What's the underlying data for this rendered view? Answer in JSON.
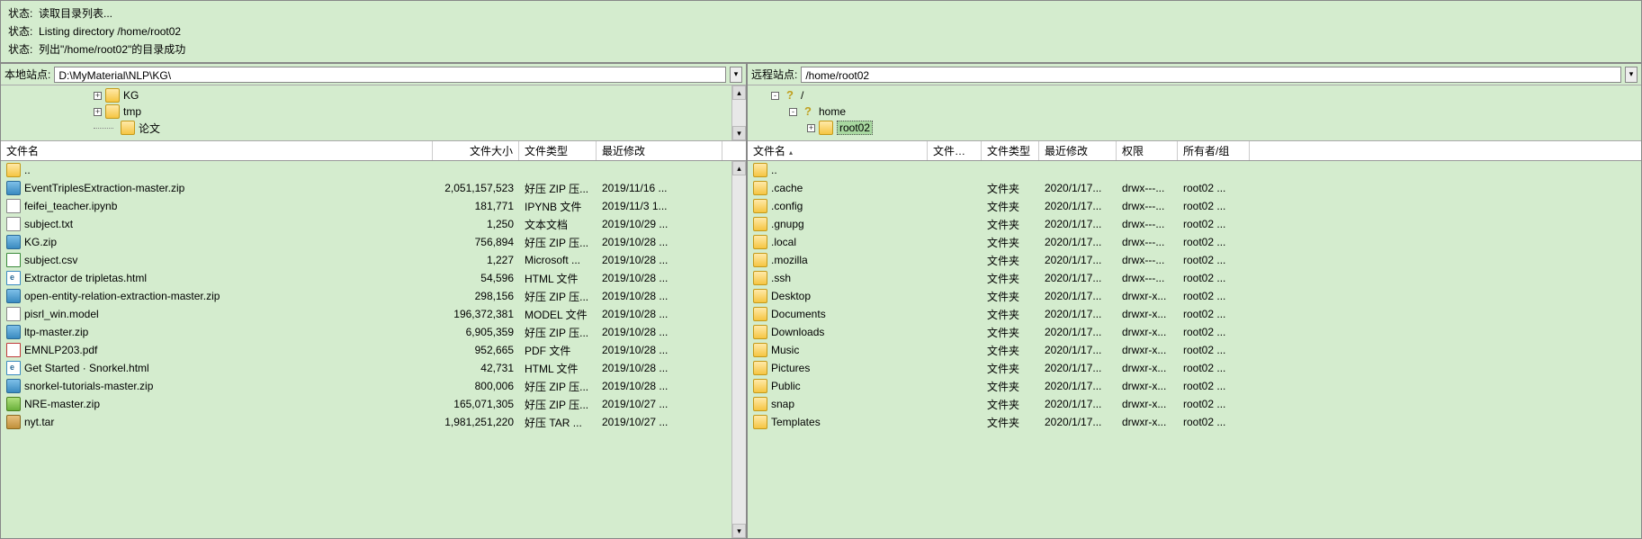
{
  "status": {
    "label": "状态:",
    "lines": [
      "读取目录列表...",
      "Listing directory /home/root02",
      "列出\"/home/root02\"的目录成功"
    ]
  },
  "local": {
    "addr_label": "本地站点:",
    "addr_value": "D:\\MyMaterial\\NLP\\KG\\",
    "tree": [
      {
        "indent": 1,
        "expander": "+",
        "icon": "folder",
        "name": "KG"
      },
      {
        "indent": 1,
        "expander": "+",
        "icon": "folder",
        "name": "tmp"
      },
      {
        "indent": 1,
        "expander": "",
        "icon": "folder",
        "name": "论文"
      }
    ],
    "headers": {
      "name": "文件名",
      "size": "文件大小",
      "type": "文件类型",
      "mod": "最近修改"
    },
    "files": [
      {
        "icon": "folder-up",
        "name": "..",
        "size": "",
        "type": "",
        "mod": ""
      },
      {
        "icon": "zip",
        "name": "EventTriplesExtraction-master.zip",
        "size": "2,051,157,523",
        "type": "好压 ZIP 压...",
        "mod": "2019/11/16 ..."
      },
      {
        "icon": "file",
        "name": "feifei_teacher.ipynb",
        "size": "181,771",
        "type": "IPYNB 文件",
        "mod": "2019/11/3 1..."
      },
      {
        "icon": "file",
        "name": "subject.txt",
        "size": "1,250",
        "type": "文本文档",
        "mod": "2019/10/29 ..."
      },
      {
        "icon": "zip",
        "name": "KG.zip",
        "size": "756,894",
        "type": "好压 ZIP 压...",
        "mod": "2019/10/28 ..."
      },
      {
        "icon": "csv",
        "name": "subject.csv",
        "size": "1,227",
        "type": "Microsoft ...",
        "mod": "2019/10/28 ..."
      },
      {
        "icon": "html",
        "name": "Extractor de tripletas.html",
        "size": "54,596",
        "type": "HTML 文件",
        "mod": "2019/10/28 ..."
      },
      {
        "icon": "zip",
        "name": "open-entity-relation-extraction-master.zip",
        "size": "298,156",
        "type": "好压 ZIP 压...",
        "mod": "2019/10/28 ..."
      },
      {
        "icon": "model",
        "name": "pisrl_win.model",
        "size": "196,372,381",
        "type": "MODEL 文件",
        "mod": "2019/10/28 ..."
      },
      {
        "icon": "zip",
        "name": "ltp-master.zip",
        "size": "6,905,359",
        "type": "好压 ZIP 压...",
        "mod": "2019/10/28 ..."
      },
      {
        "icon": "pdf",
        "name": "EMNLP203.pdf",
        "size": "952,665",
        "type": "PDF 文件",
        "mod": "2019/10/28 ..."
      },
      {
        "icon": "html",
        "name": "Get Started · Snorkel.html",
        "size": "42,731",
        "type": "HTML 文件",
        "mod": "2019/10/28 ..."
      },
      {
        "icon": "zip",
        "name": "snorkel-tutorials-master.zip",
        "size": "800,006",
        "type": "好压 ZIP 压...",
        "mod": "2019/10/28 ..."
      },
      {
        "icon": "zip2",
        "name": "NRE-master.zip",
        "size": "165,071,305",
        "type": "好压 ZIP 压...",
        "mod": "2019/10/27 ..."
      },
      {
        "icon": "tar",
        "name": "nyt.tar",
        "size": "1,981,251,220",
        "type": "好压 TAR ...",
        "mod": "2019/10/27 ..."
      }
    ]
  },
  "remote": {
    "addr_label": "远程站点:",
    "addr_value": "/home/root02",
    "tree": [
      {
        "indent": 2,
        "expander": "-",
        "icon": "q",
        "name": "/"
      },
      {
        "indent": 3,
        "expander": "-",
        "icon": "q",
        "name": "home"
      },
      {
        "indent": 4,
        "expander": "+",
        "icon": "folder",
        "name": "root02",
        "selected": true
      }
    ],
    "headers": {
      "name": "文件名",
      "size": "文件大小",
      "type": "文件类型",
      "mod": "最近修改",
      "perm": "权限",
      "own": "所有者/组"
    },
    "files": [
      {
        "icon": "folder-up",
        "name": "..",
        "size": "",
        "type": "",
        "mod": "",
        "perm": "",
        "own": ""
      },
      {
        "icon": "folder",
        "name": ".cache",
        "size": "",
        "type": "文件夹",
        "mod": "2020/1/17...",
        "perm": "drwx---...",
        "own": "root02 ..."
      },
      {
        "icon": "folder",
        "name": ".config",
        "size": "",
        "type": "文件夹",
        "mod": "2020/1/17...",
        "perm": "drwx---...",
        "own": "root02 ..."
      },
      {
        "icon": "folder",
        "name": ".gnupg",
        "size": "",
        "type": "文件夹",
        "mod": "2020/1/17...",
        "perm": "drwx---...",
        "own": "root02 ..."
      },
      {
        "icon": "folder",
        "name": ".local",
        "size": "",
        "type": "文件夹",
        "mod": "2020/1/17...",
        "perm": "drwx---...",
        "own": "root02 ..."
      },
      {
        "icon": "folder",
        "name": ".mozilla",
        "size": "",
        "type": "文件夹",
        "mod": "2020/1/17...",
        "perm": "drwx---...",
        "own": "root02 ..."
      },
      {
        "icon": "folder",
        "name": ".ssh",
        "size": "",
        "type": "文件夹",
        "mod": "2020/1/17...",
        "perm": "drwx---...",
        "own": "root02 ..."
      },
      {
        "icon": "folder",
        "name": "Desktop",
        "size": "",
        "type": "文件夹",
        "mod": "2020/1/17...",
        "perm": "drwxr-x...",
        "own": "root02 ..."
      },
      {
        "icon": "folder",
        "name": "Documents",
        "size": "",
        "type": "文件夹",
        "mod": "2020/1/17...",
        "perm": "drwxr-x...",
        "own": "root02 ..."
      },
      {
        "icon": "folder",
        "name": "Downloads",
        "size": "",
        "type": "文件夹",
        "mod": "2020/1/17...",
        "perm": "drwxr-x...",
        "own": "root02 ..."
      },
      {
        "icon": "folder",
        "name": "Music",
        "size": "",
        "type": "文件夹",
        "mod": "2020/1/17...",
        "perm": "drwxr-x...",
        "own": "root02 ..."
      },
      {
        "icon": "folder",
        "name": "Pictures",
        "size": "",
        "type": "文件夹",
        "mod": "2020/1/17...",
        "perm": "drwxr-x...",
        "own": "root02 ..."
      },
      {
        "icon": "folder",
        "name": "Public",
        "size": "",
        "type": "文件夹",
        "mod": "2020/1/17...",
        "perm": "drwxr-x...",
        "own": "root02 ..."
      },
      {
        "icon": "folder",
        "name": "snap",
        "size": "",
        "type": "文件夹",
        "mod": "2020/1/17...",
        "perm": "drwxr-x...",
        "own": "root02 ..."
      },
      {
        "icon": "folder",
        "name": "Templates",
        "size": "",
        "type": "文件夹",
        "mod": "2020/1/17...",
        "perm": "drwxr-x...",
        "own": "root02 ..."
      }
    ]
  },
  "icon_class": {
    "folder": "ic-folder",
    "folder-up": "ic-folder-up",
    "zip": "ic-zip",
    "zip2": "ic-zip2",
    "file": "ic-file",
    "html": "ic-html",
    "pdf": "ic-pdf",
    "csv": "ic-csv",
    "model": "ic-model",
    "tar": "ic-tar",
    "q": "ic-q"
  }
}
